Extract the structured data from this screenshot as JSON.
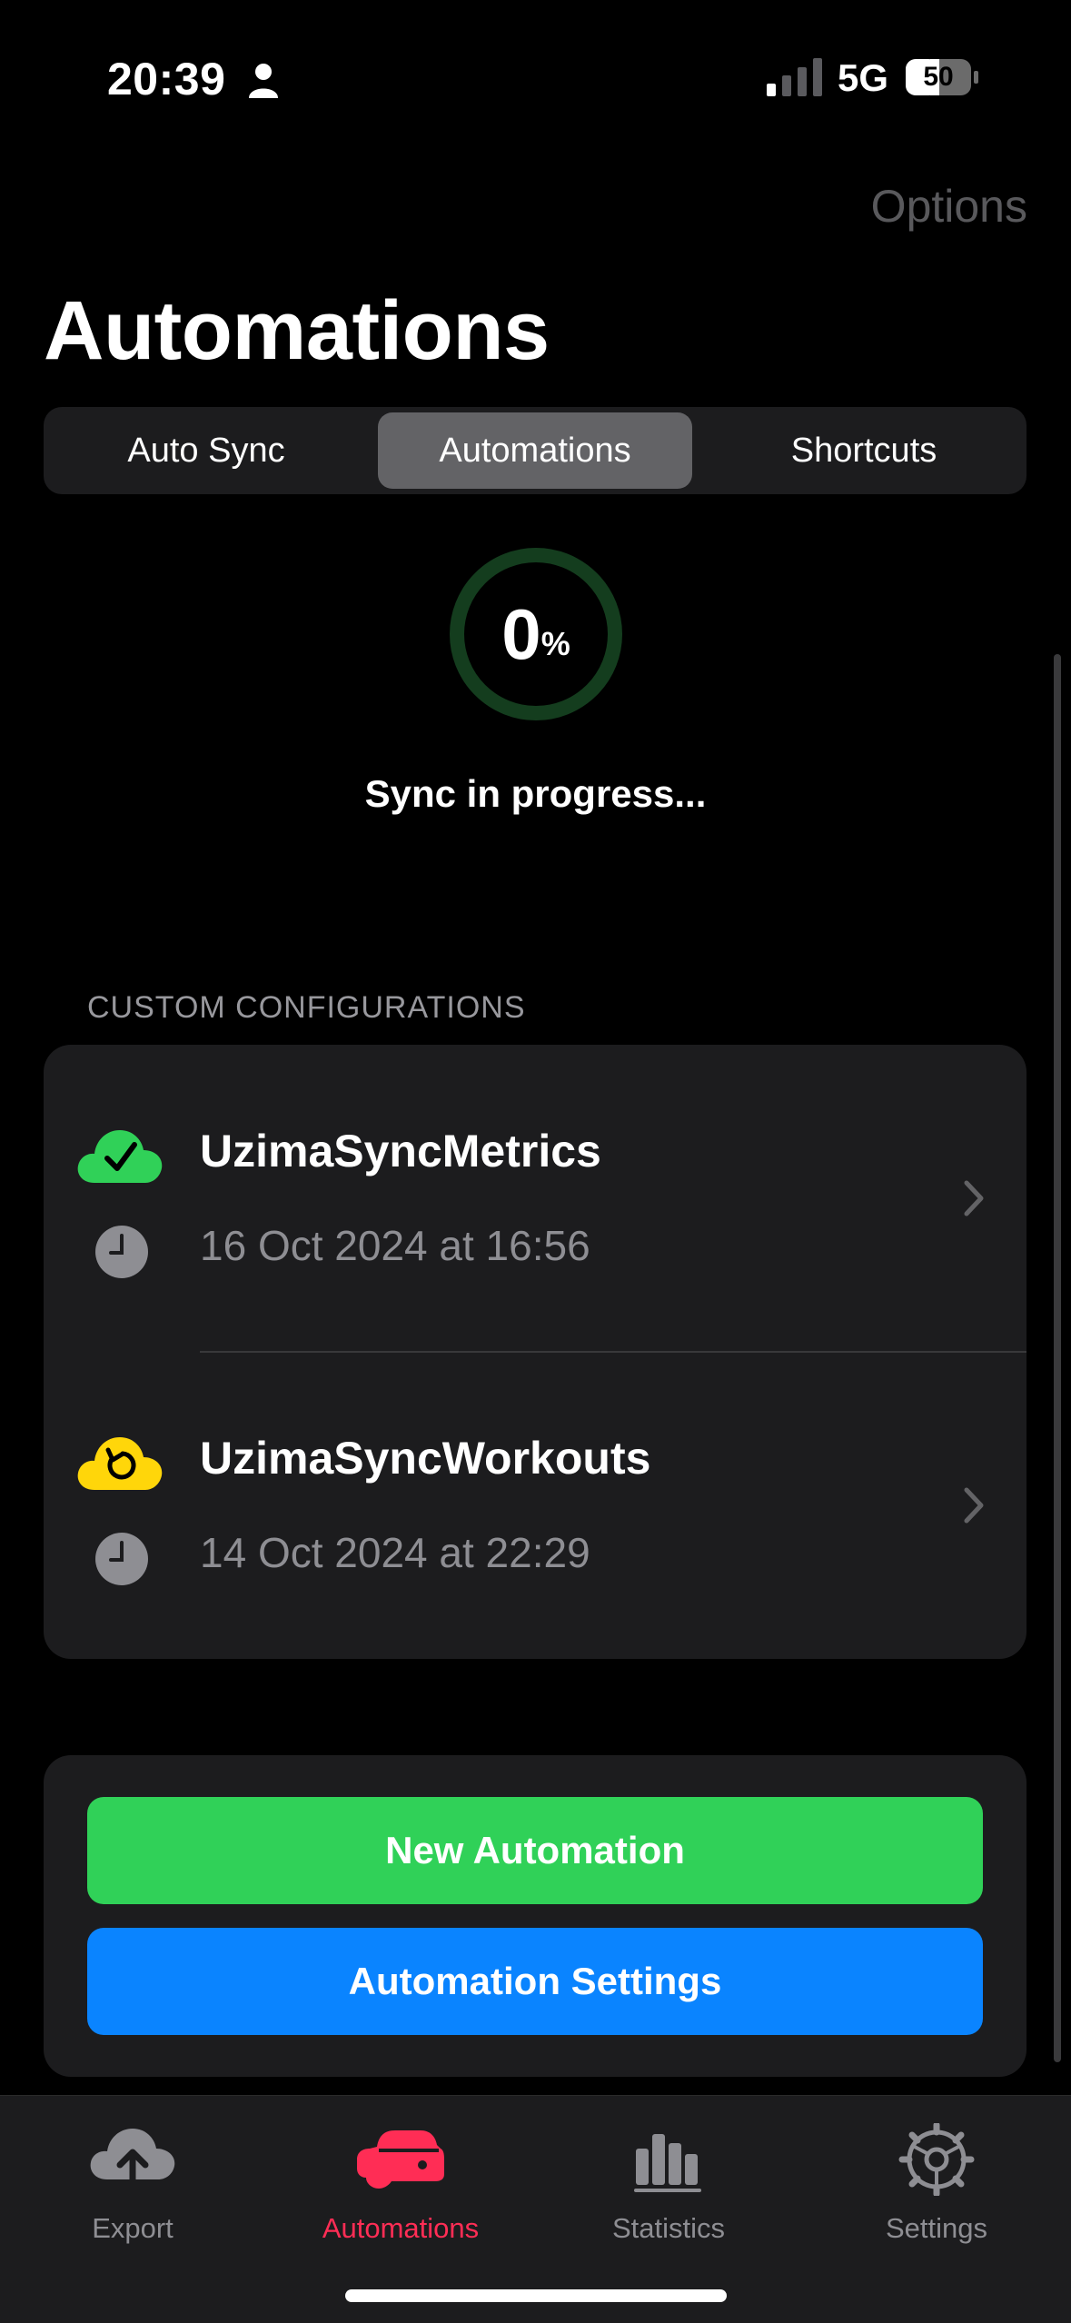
{
  "status_bar": {
    "time": "20:39",
    "network": "5G",
    "battery": "50"
  },
  "nav": {
    "options_label": "Options",
    "title": "Automations"
  },
  "segments": [
    {
      "label": "Auto Sync",
      "active": false
    },
    {
      "label": "Automations",
      "active": true
    },
    {
      "label": "Shortcuts",
      "active": false
    }
  ],
  "progress": {
    "value": "0",
    "unit": "%",
    "fraction": 0,
    "status": "Sync in progress..."
  },
  "section": {
    "header": "CUSTOM CONFIGURATIONS"
  },
  "configs": [
    {
      "name": "UzimaSyncMetrics",
      "date": "16 Oct 2024 at 16:56",
      "status_icon": "cloud-check-icon",
      "status_color": "#30d158"
    },
    {
      "name": "UzimaSyncWorkouts",
      "date": "14 Oct 2024 at 22:29",
      "status_icon": "cloud-pending-icon",
      "status_color": "#ffd60a"
    }
  ],
  "actions": {
    "new_automation": "New Automation",
    "automation_settings": "Automation Settings"
  },
  "colors": {
    "green": "#30d158",
    "blue": "#0a84ff",
    "accent": "#ff2d55",
    "ring": "#143d1e"
  },
  "tabbar": [
    {
      "label": "Export",
      "icon": "cloud-upload-icon",
      "active": false
    },
    {
      "label": "Automations",
      "icon": "car-icon",
      "active": true
    },
    {
      "label": "Statistics",
      "icon": "bar-chart-icon",
      "active": false
    },
    {
      "label": "Settings",
      "icon": "gear-icon",
      "active": false
    }
  ]
}
